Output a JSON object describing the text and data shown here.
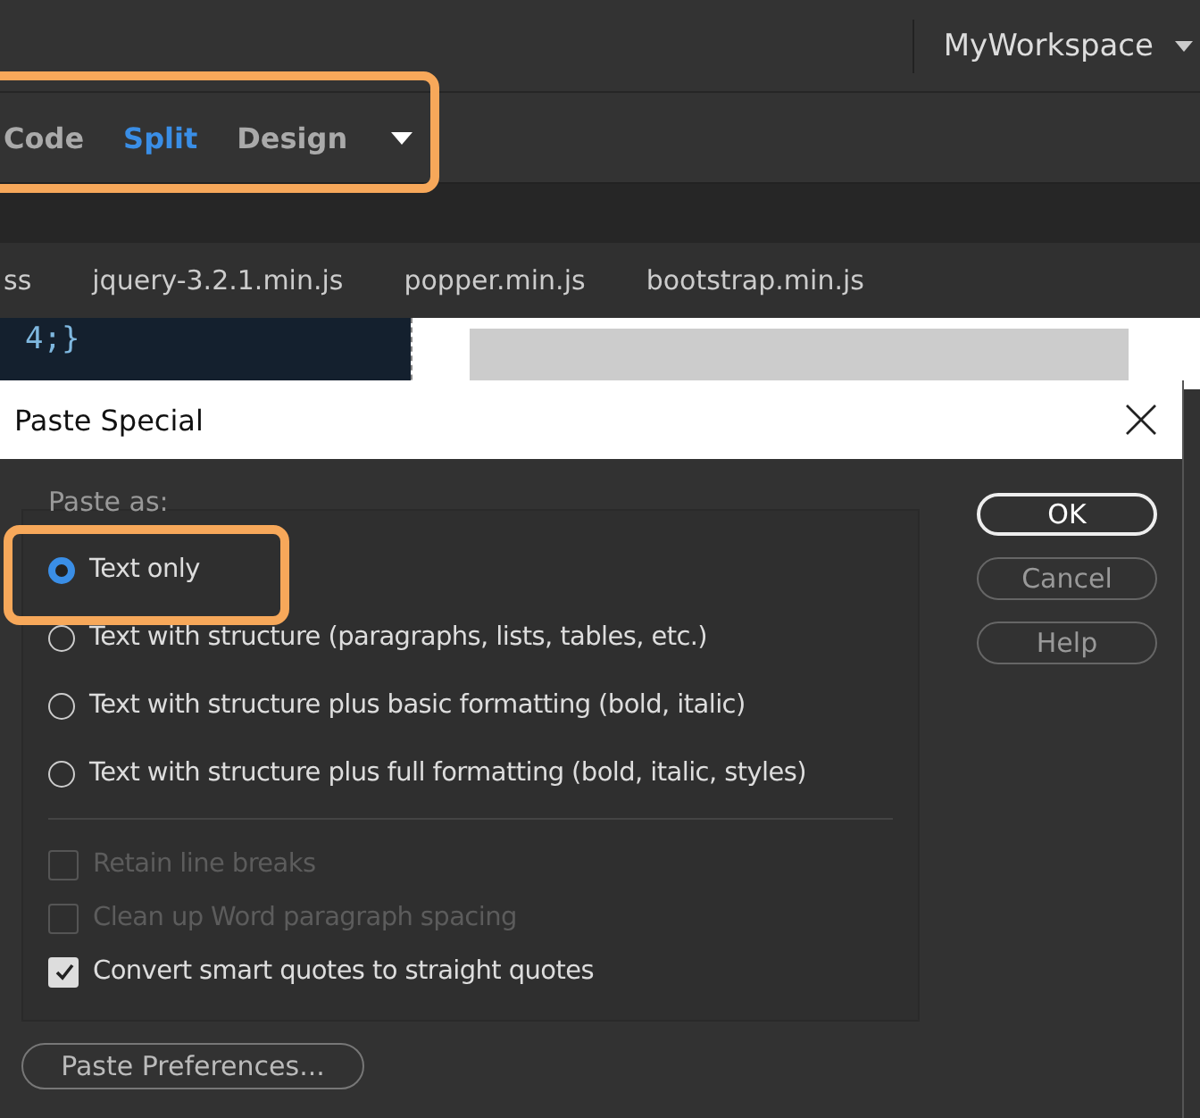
{
  "workspace": {
    "label": "MyWorkspace"
  },
  "view_switcher": [
    {
      "label": "Code",
      "selected": false
    },
    {
      "label": "Split",
      "selected": true
    },
    {
      "label": "Design",
      "selected": false
    }
  ],
  "file_tabs": [
    "ss",
    "jquery-3.2.1.min.js",
    "popper.min.js",
    "bootstrap.min.js"
  ],
  "code_lines": [
    "4;}"
  ],
  "dialog": {
    "title": "Paste Special",
    "group_label": "Paste as:",
    "options": [
      {
        "label": "Text only",
        "selected": true
      },
      {
        "label": "Text with structure (paragraphs, lists, tables, etc.)",
        "selected": false
      },
      {
        "label": "Text with structure plus basic formatting (bold, italic)",
        "selected": false
      },
      {
        "label": "Text with structure plus full formatting (bold, italic, styles)",
        "selected": false
      }
    ],
    "checkboxes": [
      {
        "label": "Retain line breaks",
        "checked": false,
        "disabled": true
      },
      {
        "label": "Clean up Word paragraph spacing",
        "checked": false,
        "disabled": true
      },
      {
        "label": "Convert smart quotes to straight quotes",
        "checked": true,
        "disabled": false
      }
    ],
    "buttons": [
      {
        "label": "OK",
        "default": true
      },
      {
        "label": "Cancel",
        "default": false
      },
      {
        "label": "Help",
        "default": false
      }
    ],
    "preferences_button": "Paste Preferences..."
  }
}
